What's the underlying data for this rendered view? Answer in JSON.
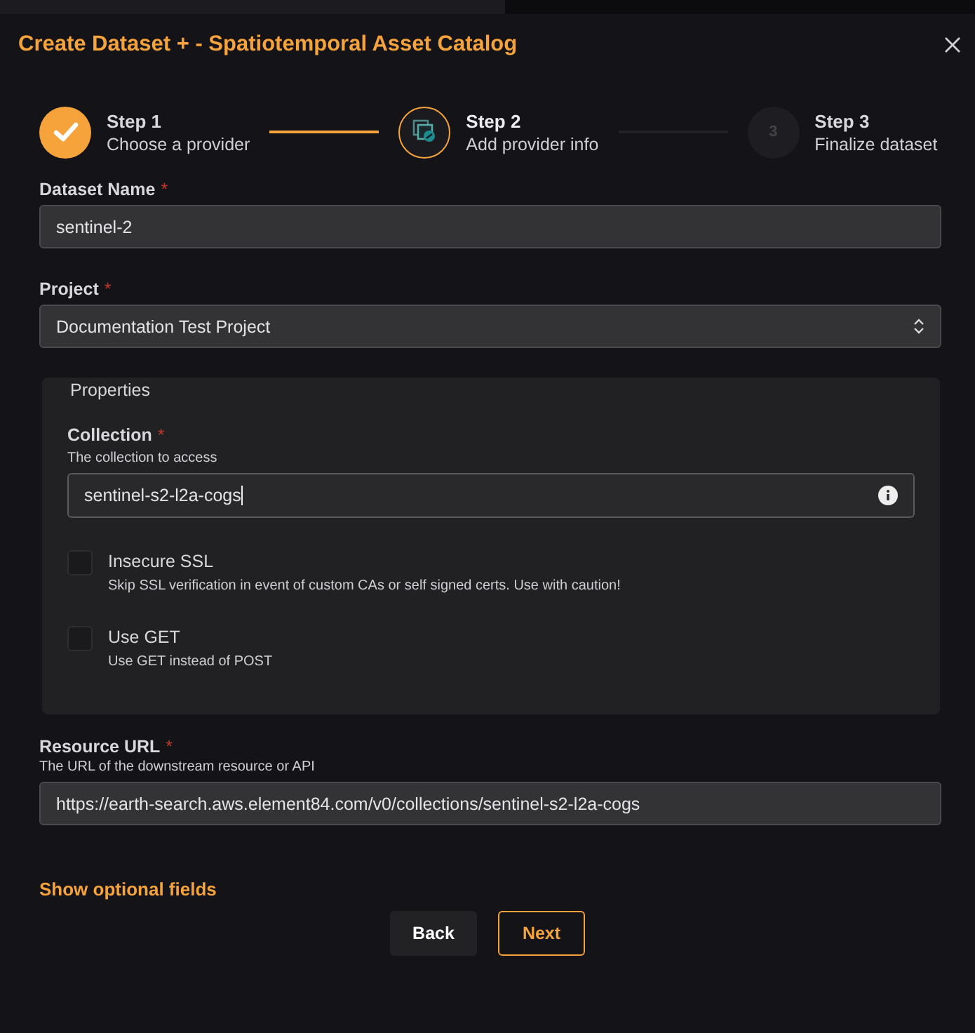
{
  "dialog": {
    "title": "Create Dataset + - Spatiotemporal Asset Catalog"
  },
  "steps": [
    {
      "title": "Step 1",
      "subtitle": "Choose a provider",
      "completed": true,
      "selected": false
    },
    {
      "title": "Step 2",
      "subtitle": "Add provider info",
      "completed": false,
      "selected": true
    },
    {
      "title": "Step 3",
      "subtitle": "Finalize dataset",
      "completed": false,
      "selected": false,
      "number": "3"
    }
  ],
  "fields": [
    {
      "kind": "input",
      "label": "Dataset Name",
      "required_mark": "*",
      "value": "sentinel-2"
    },
    {
      "kind": "select",
      "label": "Project",
      "required_mark": "*",
      "value": "Documentation Test Project"
    }
  ],
  "properties": {
    "legend": "Properties",
    "items": [
      {
        "kind": "input",
        "label": "Collection",
        "required_mark": "*",
        "help": "The collection to access",
        "value": "sentinel-s2-l2a-cogs",
        "info": true
      },
      {
        "kind": "checkbox",
        "label": "Insecure SSL",
        "help": "Skip SSL verification in event of custom CAs or self signed certs. Use with caution!",
        "checked": false
      },
      {
        "kind": "checkbox",
        "label": "Use GET",
        "help": "Use GET instead of POST",
        "checked": false
      }
    ]
  },
  "resource": {
    "kind": "input",
    "label": "Resource URL",
    "required_mark": "*",
    "help": "The URL of the downstream resource or API",
    "value": "https://earth-search.aws.element84.com/v0/collections/sentinel-s2-l2a-cogs"
  },
  "optional_link": "Show optional fields",
  "buttons": [
    {
      "label": "Back",
      "kind": "secondary"
    },
    {
      "label": "Next",
      "kind": "primary"
    }
  ]
}
